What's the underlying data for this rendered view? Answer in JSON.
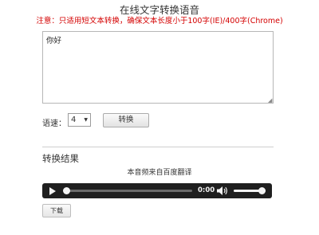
{
  "page": {
    "title": "在线文字转换语音",
    "notice": "注意：只适用短文本转换，确保文本长度小于100字(IE)/400字(Chrome)"
  },
  "input": {
    "text": "你好"
  },
  "speed": {
    "label": "语速：",
    "value": "4"
  },
  "convert_button": "转换",
  "result": {
    "heading": "转换结果",
    "source": "本音频来自百度翻译"
  },
  "player": {
    "time": "0:00",
    "progress": 0,
    "volume": 1,
    "play_icon": "play-icon",
    "volume_icon": "volume-icon"
  },
  "download_button": "下载",
  "colors": {
    "notice": "#d40000",
    "player_bg": "#1f1f1f"
  }
}
